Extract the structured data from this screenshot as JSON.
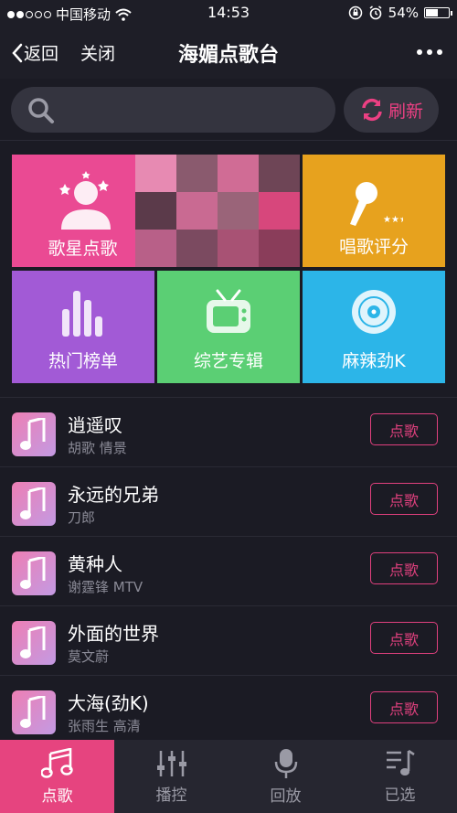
{
  "status_bar": {
    "carrier": "中国移动",
    "time": "14:53",
    "battery": "54%",
    "battery_level": 0.54
  },
  "nav": {
    "back_label": "返回",
    "close_label": "关闭",
    "title": "海媚点歌台"
  },
  "search": {
    "placeholder": "",
    "refresh_label": "刷新"
  },
  "categories": [
    {
      "label": "歌星点歌",
      "color": "#ea4a93"
    },
    {
      "label": "唱歌评分",
      "color": "#e7a21e"
    },
    {
      "label": "热门榜单",
      "color": "#a25ad6"
    },
    {
      "label": "综艺专辑",
      "color": "#5bcf74"
    },
    {
      "label": "麻辣劲K",
      "color": "#2cb5e8"
    }
  ],
  "songs": [
    {
      "title": "逍遥叹",
      "subtitle": "胡歌 情景",
      "action": "点歌"
    },
    {
      "title": "永远的兄弟",
      "subtitle": "刀郎",
      "action": "点歌"
    },
    {
      "title": "黄种人",
      "subtitle": "谢霆锋 MTV",
      "action": "点歌"
    },
    {
      "title": "外面的世界",
      "subtitle": "莫文蔚",
      "action": "点歌"
    },
    {
      "title": "大海(劲K)",
      "subtitle": "张雨生 高清",
      "action": "点歌"
    }
  ],
  "tabs": [
    {
      "label": "点歌",
      "icon": "music-notes-icon",
      "active": true
    },
    {
      "label": "播控",
      "icon": "sliders-icon",
      "active": false
    },
    {
      "label": "回放",
      "icon": "microphone-icon",
      "active": false
    },
    {
      "label": "已选",
      "icon": "playlist-icon",
      "active": false
    }
  ],
  "colors": {
    "accent": "#e6447f",
    "background": "#1b1b24"
  }
}
